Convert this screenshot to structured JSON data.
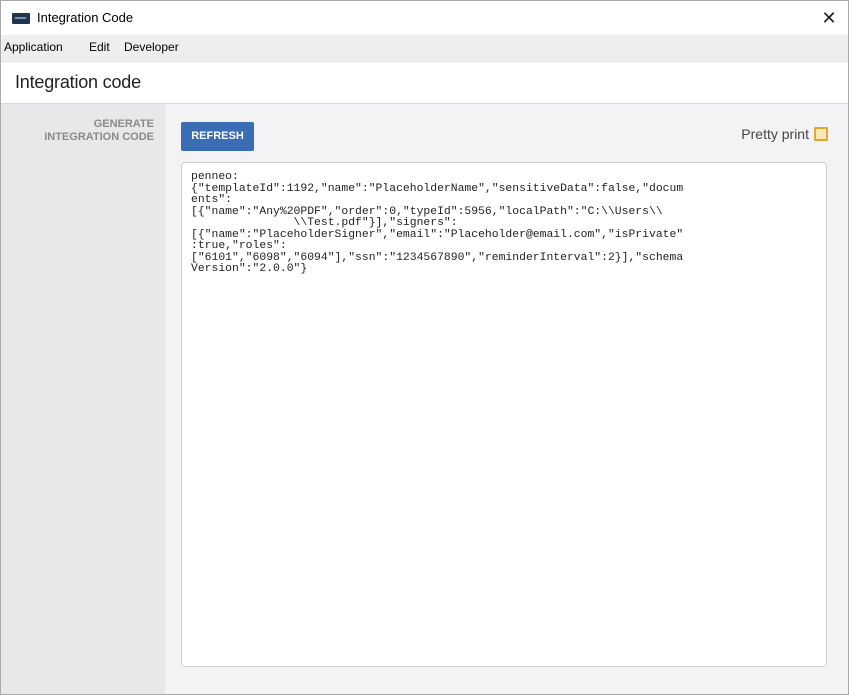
{
  "window": {
    "title": "Integration Code",
    "close_glyph": "✕"
  },
  "menubar": {
    "items": [
      "Application",
      "Edit",
      "Developer"
    ]
  },
  "page": {
    "title": "Integration code"
  },
  "sidebar": {
    "section_label": "GENERATE\nINTEGRATION CODE"
  },
  "toolbar": {
    "refresh_label": "REFRESH",
    "pretty_print_label": "Pretty print",
    "pretty_print_checked": false
  },
  "code": {
    "content": "penneo:\n{\"templateId\":1192,\"name\":\"PlaceholderName\",\"sensitiveData\":false,\"docum\nents\":\n[{\"name\":\"Any%20PDF\",\"order\":0,\"typeId\":5956,\"localPath\":\"C:\\\\Users\\\\\n               \\\\Test.pdf\"}],\"signers\":\n[{\"name\":\"PlaceholderSigner\",\"email\":\"Placeholder@email.com\",\"isPrivate\"\n:true,\"roles\":\n[\"6101\",\"6098\",\"6094\"],\"ssn\":\"1234567890\",\"reminderInterval\":2}],\"schema\nVersion\":\"2.0.0\"}"
  },
  "colors": {
    "accent_button": "#3a6db3",
    "checkbox_border": "#e0a832",
    "sidebar_bg": "#e8e8ea",
    "content_bg": "#f3f3f5"
  },
  "icons": {
    "app": "app-icon",
    "close": "close-icon",
    "checkbox": "checkbox-icon"
  }
}
